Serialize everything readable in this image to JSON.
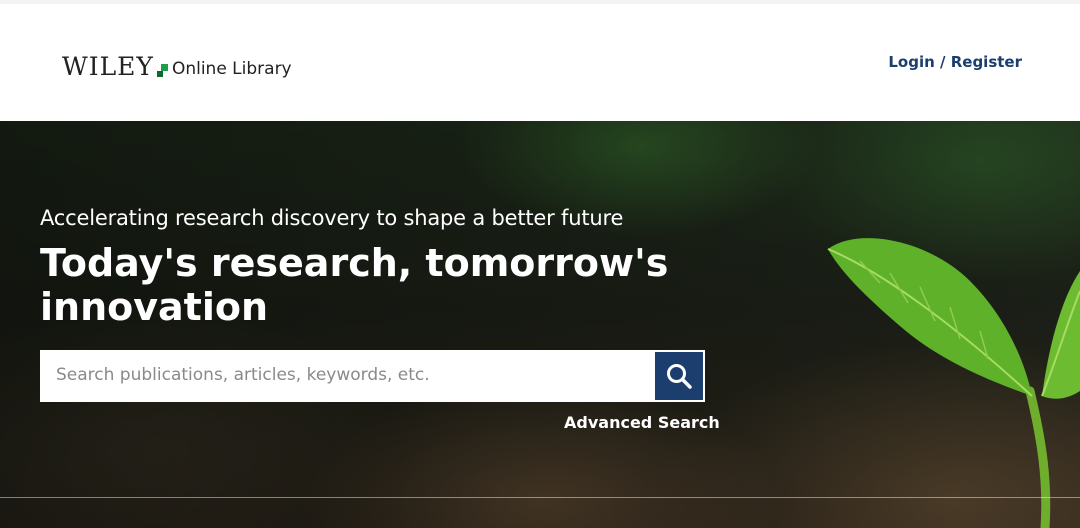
{
  "header": {
    "logo_wordmark": "WILEY",
    "logo_subtitle": "Online Library",
    "login_label": "Login / Register"
  },
  "hero": {
    "tagline": "Accelerating research discovery to shape a better future",
    "headline": "Today's research, tomorrow's innovation",
    "search": {
      "placeholder": "Search publications, articles, keywords, etc.",
      "value": "",
      "button_icon": "search-icon"
    },
    "advanced_search_label": "Advanced Search"
  },
  "colors": {
    "brand_navy": "#1c3e6e",
    "brand_green": "#1f9e4a"
  }
}
